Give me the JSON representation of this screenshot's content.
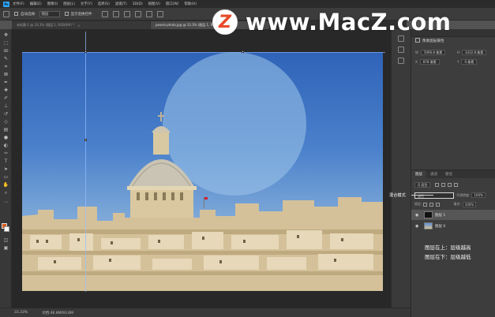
{
  "menubar": {
    "logo": "Ps",
    "items": [
      "文件(F)",
      "编辑(E)",
      "图像(I)",
      "图层(L)",
      "文字(Y)",
      "选择(S)",
      "滤镜(T)",
      "3D(D)",
      "视图(V)",
      "窗口(W)",
      "帮助(H)"
    ]
  },
  "options": {
    "auto_select_label": "自动选择:",
    "auto_select_value": "图层",
    "show_transform_label": "显示变换控件"
  },
  "tabs": [
    {
      "label": "未标题-1 @ 33.3% (图层 1, RGB/8#) *"
    },
    {
      "label": "pexels-photo.jpg @ 33.3% (图层 1, RGB/8)"
    }
  ],
  "status": {
    "zoom": "33.33%",
    "doc_size": "文档:46.8M/93.6M"
  },
  "properties": {
    "title": "像素图层属性",
    "w_label": "W",
    "w_value": "5096.8 像素",
    "h_label": "H",
    "h_value": "3432.8 像素",
    "x_label": "X",
    "x_value": "878 像素",
    "y_label": "Y",
    "y_value": "0 像素"
  },
  "layers": {
    "tabs": [
      "图层",
      "通道",
      "路径"
    ],
    "kind": "Q 类型",
    "blend_mode": "滤色",
    "opacity_label": "不透明度:",
    "opacity_value": "100%",
    "lock_label": "锁定:",
    "fill_label": "填充:",
    "fill_value": "100%",
    "items": [
      {
        "name": "图层 1",
        "selected": true
      },
      {
        "name": "图层 0",
        "selected": false
      }
    ]
  },
  "annotations": {
    "blend_mode_label": "混合模式",
    "upper_note": "图层在上：层级越高",
    "lower_note": "图层在下：层级越低"
  },
  "watermark": {
    "logo_letter": "Z",
    "text": "www.MacZ.com"
  },
  "colors": {
    "foreground": "#d85c1c",
    "background": "#ffffff",
    "accent": "#31a8ff",
    "watermark_logo": "#e84b2a"
  }
}
